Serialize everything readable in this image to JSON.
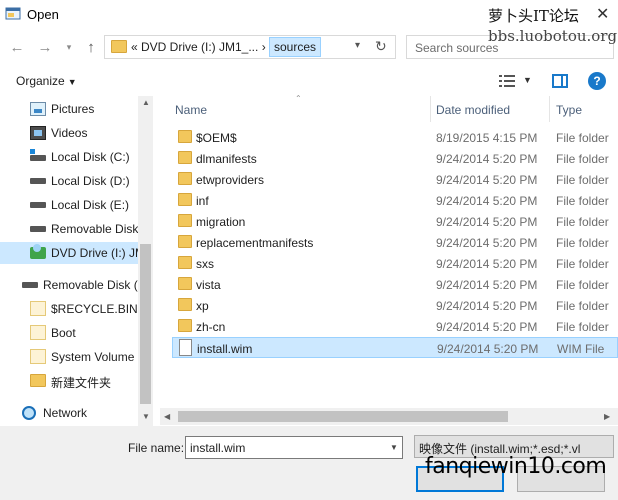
{
  "window": {
    "title": "Open",
    "watermark_top": "萝卜头IT论坛",
    "watermark_url": "bbs.luobotou.org",
    "watermark_bottom": "fanqiewin10.com"
  },
  "address_bar": {
    "path_prefix": "«  DVD Drive (I:) JM1_...  ›",
    "current": "sources",
    "search_placeholder": "Search sources"
  },
  "toolbar": {
    "organize_label": "Organize"
  },
  "nav_pane": {
    "items": [
      {
        "label": "Pictures",
        "icon": "pictures-icon"
      },
      {
        "label": "Videos",
        "icon": "videos-icon"
      },
      {
        "label": "Local Disk (C:)",
        "icon": "windows-disk-icon"
      },
      {
        "label": "Local Disk (D:)",
        "icon": "disk-icon"
      },
      {
        "label": "Local Disk (E:)",
        "icon": "disk-icon"
      },
      {
        "label": "Removable Disk",
        "icon": "disk-icon"
      },
      {
        "label": "DVD Drive (I:) JM",
        "icon": "dvd-icon"
      },
      {
        "label": "Removable Disk (F",
        "icon": "disk-icon"
      },
      {
        "label": "$RECYCLE.BIN",
        "icon": "folder-light-icon"
      },
      {
        "label": "Boot",
        "icon": "folder-light-icon"
      },
      {
        "label": "System Volume I",
        "icon": "folder-light-icon"
      },
      {
        "label": "新建文件夹",
        "icon": "folder-icon"
      },
      {
        "label": "Network",
        "icon": "network-icon"
      }
    ]
  },
  "file_list": {
    "columns": {
      "name": "Name",
      "date": "Date modified",
      "type": "Type"
    },
    "rows": [
      {
        "name": "$OEM$",
        "date": "8/19/2015 4:15 PM",
        "type": "File folder"
      },
      {
        "name": "dlmanifests",
        "date": "9/24/2014 5:20 PM",
        "type": "File folder"
      },
      {
        "name": "etwproviders",
        "date": "9/24/2014 5:20 PM",
        "type": "File folder"
      },
      {
        "name": "inf",
        "date": "9/24/2014 5:20 PM",
        "type": "File folder"
      },
      {
        "name": "migration",
        "date": "9/24/2014 5:20 PM",
        "type": "File folder"
      },
      {
        "name": "replacementmanifests",
        "date": "9/24/2014 5:20 PM",
        "type": "File folder"
      },
      {
        "name": "sxs",
        "date": "9/24/2014 5:20 PM",
        "type": "File folder"
      },
      {
        "name": "vista",
        "date": "9/24/2014 5:20 PM",
        "type": "File folder"
      },
      {
        "name": "xp",
        "date": "9/24/2014 5:20 PM",
        "type": "File folder"
      },
      {
        "name": "zh-cn",
        "date": "9/24/2014 5:20 PM",
        "type": "File folder"
      },
      {
        "name": "install.wim",
        "date": "9/24/2014 5:20 PM",
        "type": "WIM File"
      }
    ]
  },
  "bottom": {
    "file_name_label": "File name:",
    "file_name_value": "install.wim",
    "file_type_value": "映像文件 (install.wim;*.esd;*.vl"
  }
}
